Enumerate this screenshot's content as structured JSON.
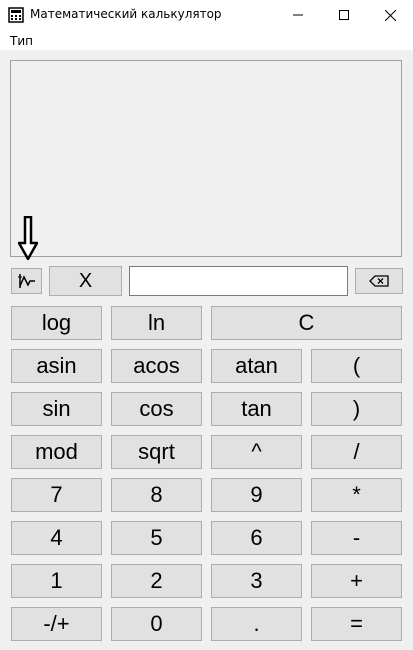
{
  "window": {
    "title": "Математический калькулятор"
  },
  "menu": {
    "type_label": "Тип"
  },
  "toolbar": {
    "graph_icon": "graph-icon",
    "x_label": "X",
    "input_value": "",
    "backspace_icon": "backspace-icon"
  },
  "keys": {
    "log": "log",
    "ln": "ln",
    "clear": "C",
    "asin": "asin",
    "acos": "acos",
    "atan": "atan",
    "lparen": "(",
    "sin": "sin",
    "cos": "cos",
    "tan": "tan",
    "rparen": ")",
    "mod": "mod",
    "sqrt": "sqrt",
    "pow": "^",
    "div": "/",
    "d7": "7",
    "d8": "8",
    "d9": "9",
    "mul": "*",
    "d4": "4",
    "d5": "5",
    "d6": "6",
    "sub": "-",
    "d1": "1",
    "d2": "2",
    "d3": "3",
    "add": "+",
    "neg": "-/+",
    "d0": "0",
    "dot": ".",
    "eq": "="
  }
}
